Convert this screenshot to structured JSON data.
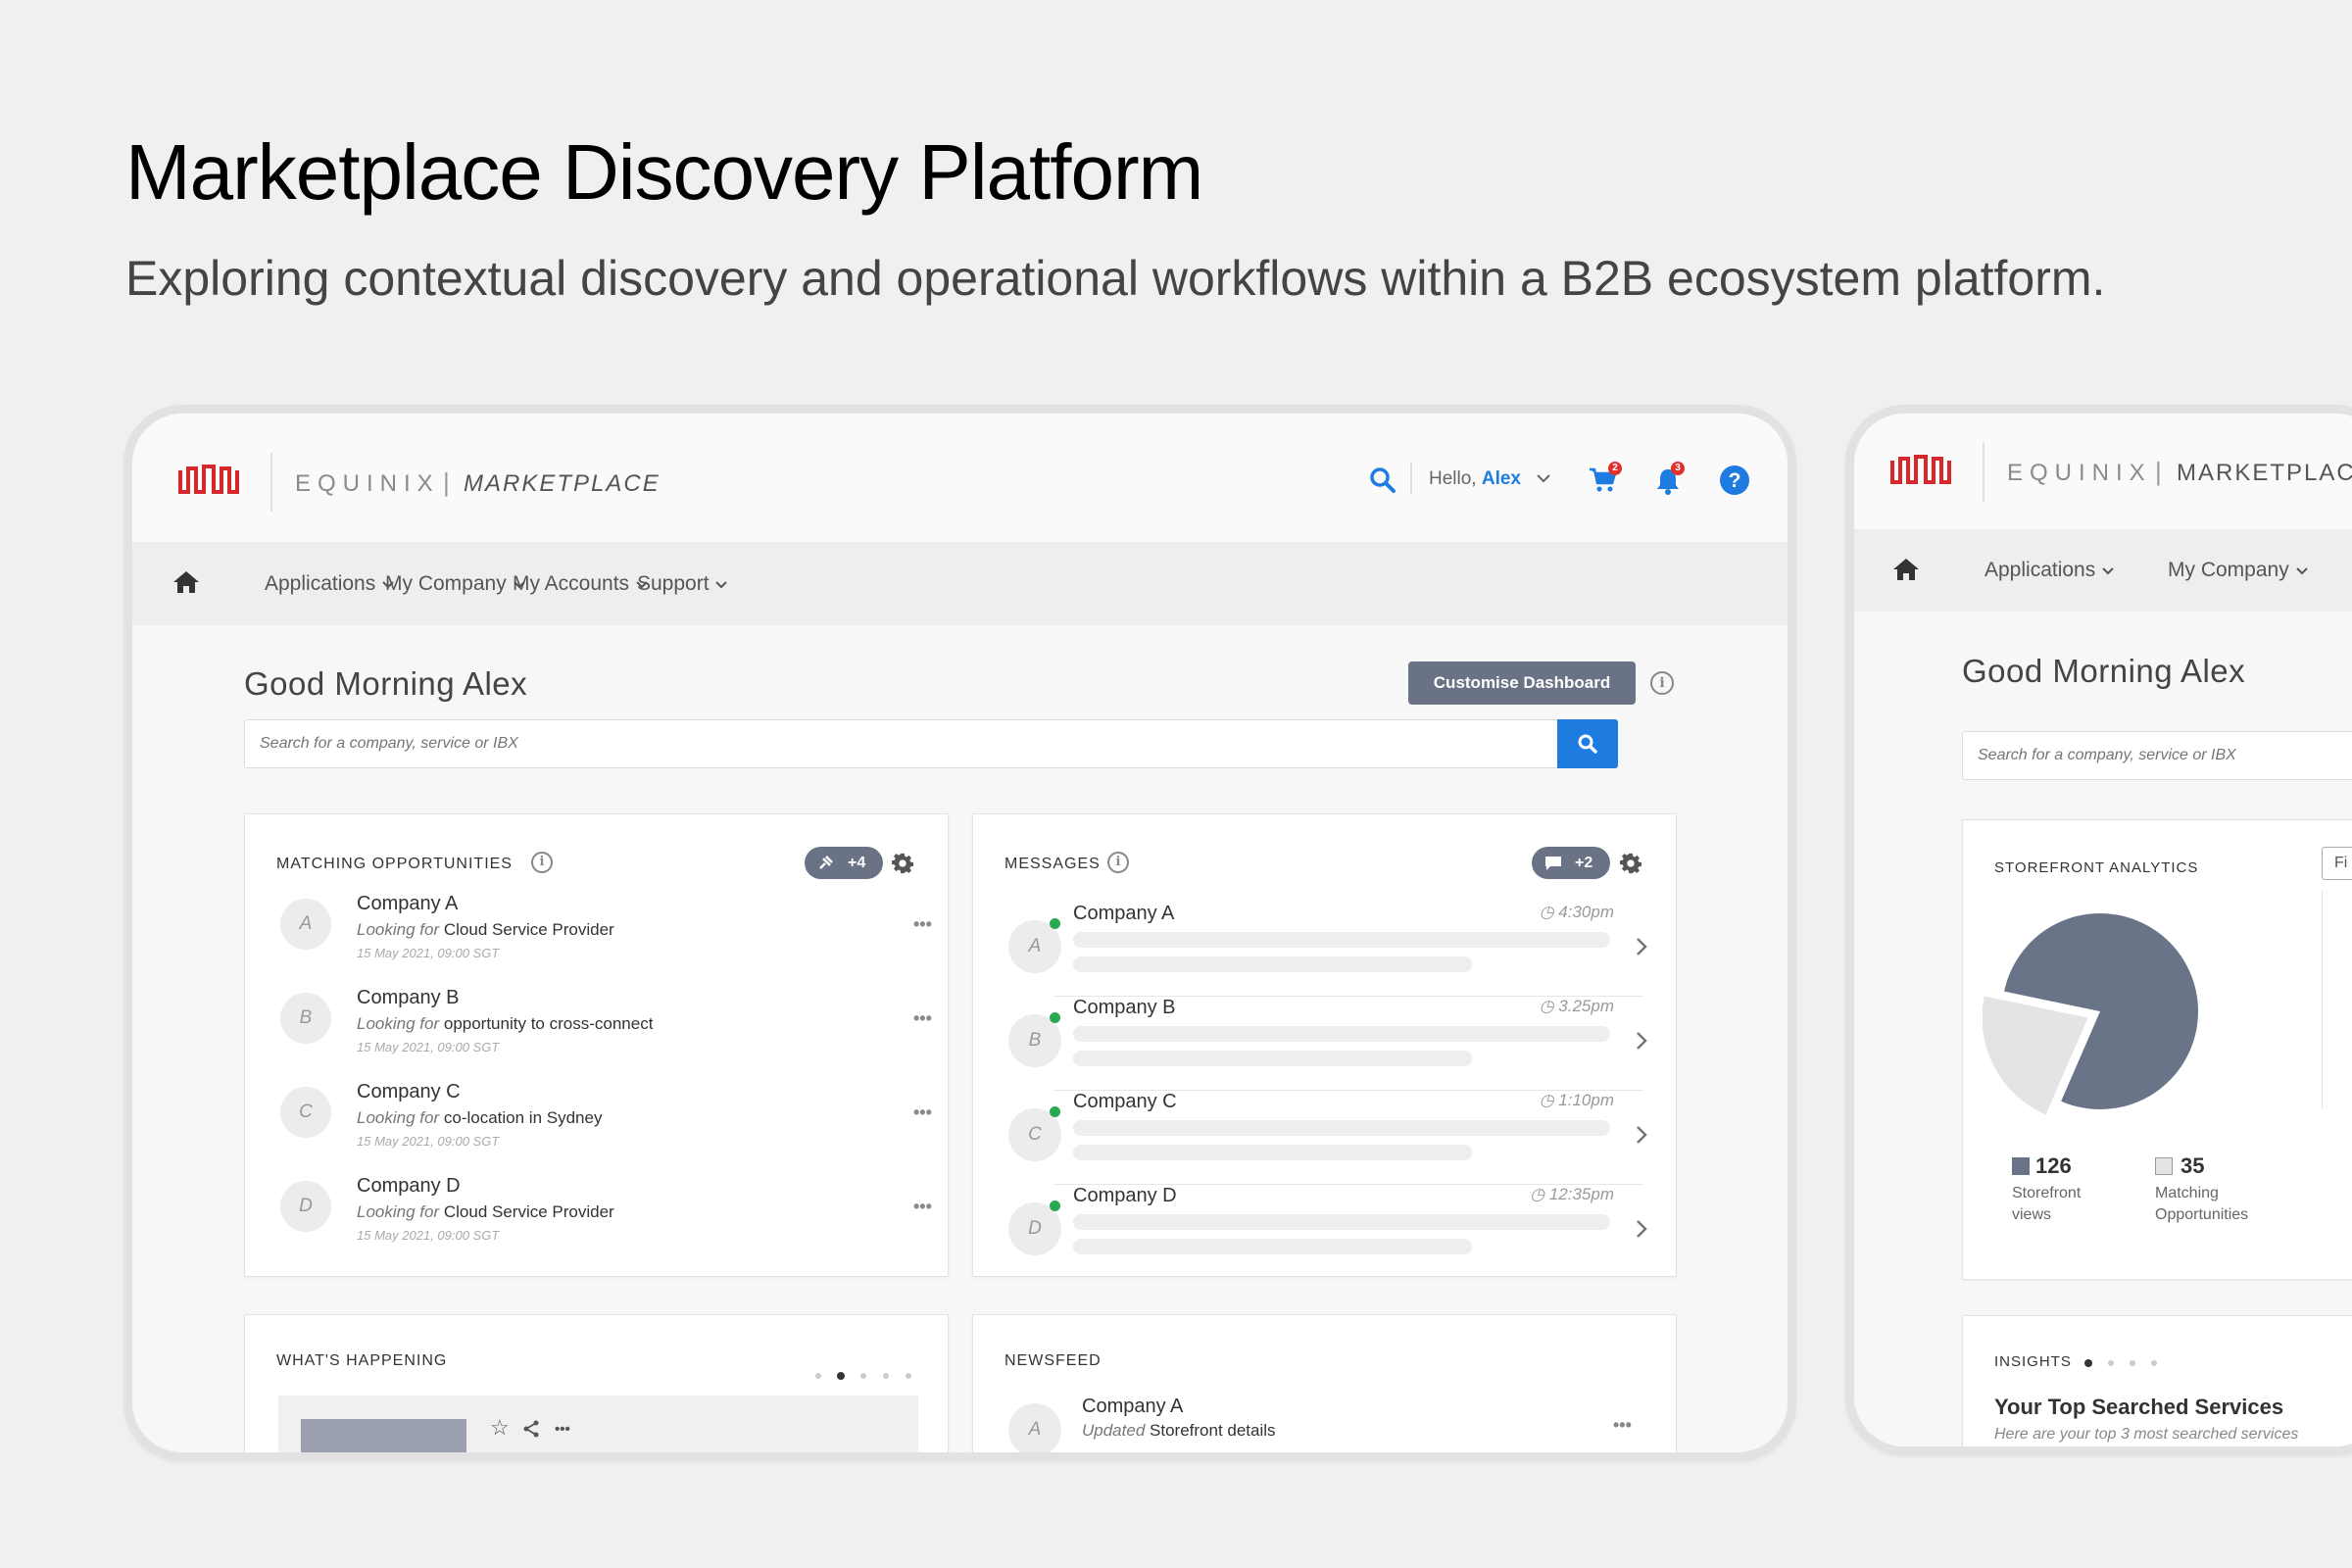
{
  "hero": {
    "title": "Marketplace Discovery Platform",
    "subtitle": "Exploring contextual discovery and operational workflows within a B2B ecosystem platform."
  },
  "brand": {
    "name": "EQUINIX",
    "separator": "|",
    "product": "MARKETPLACE"
  },
  "topbar": {
    "greeting": "Hello,",
    "user": "Alex",
    "cart_count": "2",
    "notification_count": "3"
  },
  "nav": {
    "items": [
      "Applications",
      "My Company",
      "My Accounts",
      "Support"
    ]
  },
  "dashboard": {
    "greeting": "Good Morning Alex",
    "customise_label": "Customise Dashboard",
    "search_placeholder": "Search for a company, service or IBX"
  },
  "opportunities": {
    "title": "MATCHING OPPORTUNITIES",
    "pill": "+4",
    "items": [
      {
        "initial": "A",
        "company": "Company A",
        "looking": "Looking for",
        "need": "Cloud Service Provider",
        "date": "15 May 2021, 09:00 SGT"
      },
      {
        "initial": "B",
        "company": "Company B",
        "looking": "Looking for",
        "need": "opportunity to cross-connect",
        "date": "15 May 2021, 09:00 SGT"
      },
      {
        "initial": "C",
        "company": "Company C",
        "looking": "Looking for",
        "need": "co-location in Sydney",
        "date": "15 May 2021, 09:00 SGT"
      },
      {
        "initial": "D",
        "company": "Company D",
        "looking": "Looking for",
        "need": "Cloud Service Provider",
        "date": "15 May 2021, 09:00 SGT"
      }
    ]
  },
  "messages": {
    "title": "MESSAGES",
    "pill": "+2",
    "items": [
      {
        "initial": "A",
        "company": "Company A",
        "time": "4:30pm"
      },
      {
        "initial": "B",
        "company": "Company B",
        "time": "3.25pm"
      },
      {
        "initial": "C",
        "company": "Company C",
        "time": "1:10pm"
      },
      {
        "initial": "D",
        "company": "Company D",
        "time": "12:35pm"
      }
    ]
  },
  "whats_happening": {
    "title": "WHAT'S HAPPENING"
  },
  "newsfeed": {
    "title": "NEWSFEED",
    "item": {
      "initial": "A",
      "company": "Company A",
      "action": "Updated",
      "detail": "Storefront details"
    }
  },
  "second_screen": {
    "nav_items": [
      "Applications",
      "My Company"
    ],
    "analytics_title": "STOREFRONT ANALYTICS",
    "filter_label": "Fi",
    "chart_data": {
      "type": "pie",
      "categories": [
        "Storefront views",
        "Matching Opportunities"
      ],
      "values": [
        126,
        35
      ],
      "colors": [
        "#6a7489",
        "#e4e4e4"
      ]
    },
    "legend": [
      {
        "value": "126",
        "label_line1": "Storefront",
        "label_line2": "views"
      },
      {
        "value": "35",
        "label_line1": "Matching",
        "label_line2": "Opportunities"
      }
    ],
    "insights_title": "INSIGHTS",
    "insights_heading": "Your Top Searched Services",
    "insights_sub": "Here are your top 3 most searched services"
  },
  "colors": {
    "accent": "#1e7be0",
    "pill": "#6a7285",
    "brand_red": "#d6282b",
    "online": "#27a950"
  }
}
